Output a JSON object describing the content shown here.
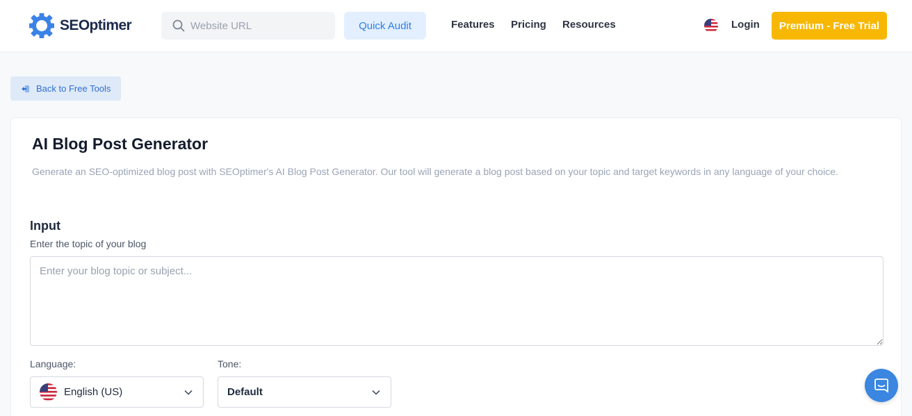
{
  "header": {
    "brand_name": "SEOptimer",
    "search_placeholder": "Website URL",
    "quick_audit_label": "Quick Audit",
    "nav": [
      {
        "label": "Features"
      },
      {
        "label": "Pricing"
      },
      {
        "label": "Resources"
      }
    ],
    "login_label": "Login",
    "premium_label": "Premium - Free Trial",
    "icons": {
      "logo": "gear-logo-icon",
      "search": "search-icon",
      "flag": "us-flag-icon"
    }
  },
  "back_button": {
    "label": "Back to Free Tools",
    "icon": "back-arrow-icon"
  },
  "main": {
    "title": "AI Blog Post Generator",
    "description": "Generate an SEO-optimized blog post with SEOptimer's AI Blog Post Generator. Our tool will generate a blog post based on your topic and target keywords in any language of your choice.",
    "input_heading": "Input",
    "topic_label": "Enter the topic of your blog",
    "topic_placeholder": "Enter your blog topic or subject...",
    "language_label": "Language:",
    "language_value": "English (US)",
    "tone_label": "Tone:",
    "tone_value": "Default"
  },
  "chat": {
    "icon": "chat-icon"
  },
  "colors": {
    "accent_blue": "#2f7fe0",
    "premium_yellow": "#f7b703",
    "quick_audit_bg": "#e3efff",
    "back_button_bg": "#dfeaf8",
    "chat_blue": "#3a86e0"
  }
}
